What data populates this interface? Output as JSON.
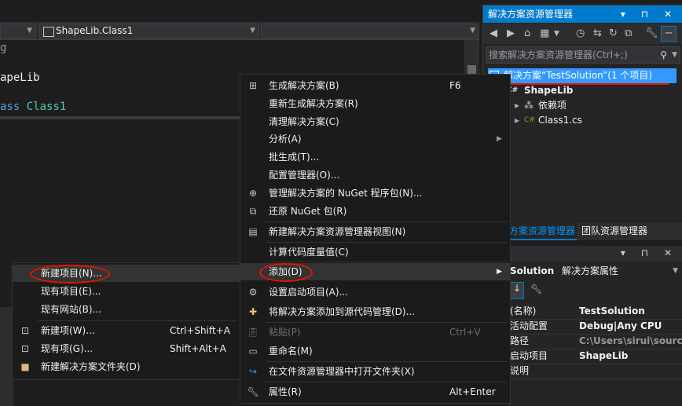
{
  "editor": {
    "nav_left": "",
    "nav_middle": "ShapeLib.Class1",
    "code": [
      "g",
      "apeLib",
      "ass Class1"
    ],
    "code_kw": "ass",
    "code_ty": "Class1"
  },
  "solution_explorer": {
    "title": "解决方案资源管理器",
    "title_buttons": "▾ ⊓ ✕",
    "search_placeholder": "搜索解决方案资源管理器(Ctrl+;)",
    "tree": [
      {
        "label": "解决方案“TestSolution”(1 个项目)"
      },
      {
        "label": "ShapeLib",
        "badge": "C#"
      },
      {
        "label": "依赖项"
      },
      {
        "label": "Class1.cs",
        "badge": "C#"
      }
    ],
    "tabs": [
      "方案资源管理器",
      "团队资源管理器"
    ]
  },
  "properties": {
    "title_buttons": "▾ ⊓ ✕",
    "header_name": "Solution",
    "header_desc": "解决方案属性",
    "rows": [
      {
        "name": "(名称)",
        "value": "TestSolution"
      },
      {
        "name": "活动配置",
        "value": "Debug|Any CPU"
      },
      {
        "name": "路径",
        "value": "C:\\Users\\sirui\\source"
      },
      {
        "name": "启动项目",
        "value": "ShapeLib"
      },
      {
        "name": "说明",
        "value": ""
      }
    ]
  },
  "main_menu": {
    "items": [
      {
        "label": "生成解决方案(B)",
        "shortcut": "F6"
      },
      {
        "label": "重新生成解决方案(R)",
        "shortcut": ""
      },
      {
        "label": "清理解决方案(C)",
        "shortcut": ""
      },
      {
        "label": "分析(A)",
        "shortcut": ""
      },
      {
        "label": "批生成(T)...",
        "shortcut": ""
      },
      {
        "label": "配置管理器(O)...",
        "shortcut": ""
      },
      {
        "label": "管理解决方案的 NuGet 程序包(N)...",
        "shortcut": ""
      },
      {
        "label": "还原 NuGet 包(R)",
        "shortcut": ""
      },
      {
        "label": "新建解决方案资源管理器视图(N)",
        "shortcut": ""
      },
      {
        "label": "计算代码度量值(C)",
        "shortcut": ""
      },
      {
        "label": "添加(D)",
        "shortcut": ""
      },
      {
        "label": "设置启动项目(A)...",
        "shortcut": ""
      },
      {
        "label": "将解决方案添加到源代码管理(D)...",
        "shortcut": ""
      },
      {
        "label": "粘贴(P)",
        "shortcut": "Ctrl+V"
      },
      {
        "label": "重命名(M)",
        "shortcut": ""
      },
      {
        "label": "在文件资源管理器中打开文件夹(X)",
        "shortcut": ""
      },
      {
        "label": "属性(R)",
        "shortcut": "Alt+Enter"
      }
    ]
  },
  "add_submenu": {
    "items": [
      {
        "label": "新建项目(N)...",
        "shortcut": ""
      },
      {
        "label": "现有项目(E)...",
        "shortcut": ""
      },
      {
        "label": "现有网站(B)...",
        "shortcut": ""
      },
      {
        "label": "新建项(W)...",
        "shortcut": "Ctrl+Shift+A"
      },
      {
        "label": "现有项(G)...",
        "shortcut": "Shift+Alt+A"
      },
      {
        "label": "新建解决方案文件夹(D)",
        "shortcut": ""
      }
    ]
  },
  "colors": {
    "accent": "#007acc",
    "highlight_circle": "#e51400",
    "selection": "#3399ff"
  }
}
